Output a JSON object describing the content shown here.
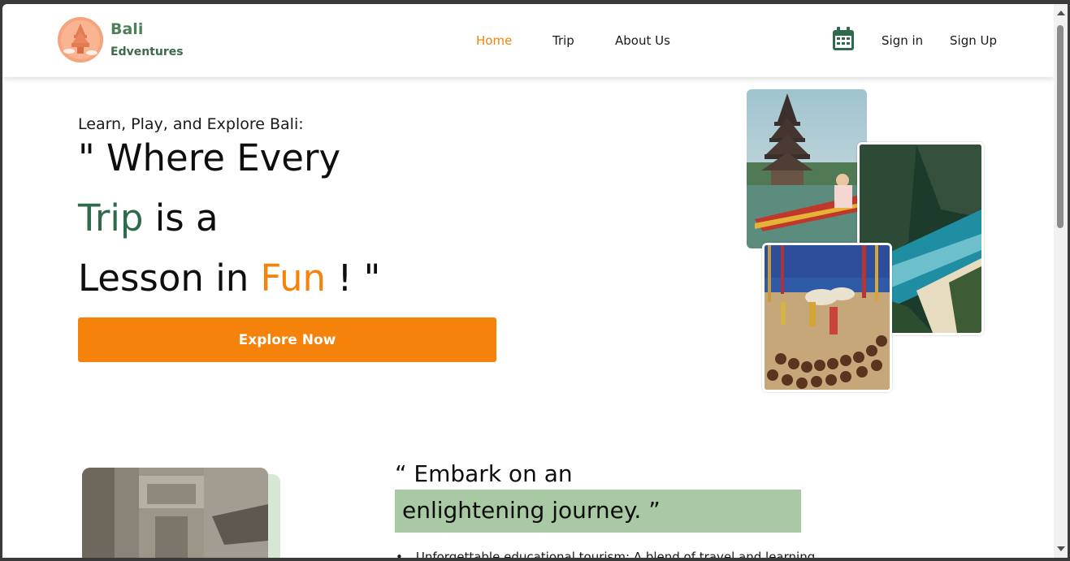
{
  "brand": {
    "name": "Bali",
    "tagline": "Edventures"
  },
  "nav": {
    "links": [
      {
        "label": "Home",
        "active": true
      },
      {
        "label": "Trip",
        "active": false
      },
      {
        "label": "About Us",
        "active": false
      }
    ],
    "calendar_icon": "calendar-icon",
    "sign_in": "Sign in",
    "sign_up": "Sign Up"
  },
  "hero": {
    "intro": "Learn, Play, and Explore Bali:",
    "line1": "\" Where Every",
    "line2_highlight": "Trip",
    "line2_rest": " is a",
    "line3_start": "Lesson in ",
    "line3_highlight": "Fun",
    "line3_end": " ! \"",
    "cta_label": "Explore Now"
  },
  "section2": {
    "heading_line1": "“ Embark on an",
    "heading_line2": "enlightening journey. ”",
    "bullet_1": "Unforgettable educational tourism: A blend of travel and learning"
  },
  "colors": {
    "accent_orange": "#f5820a",
    "brand_green": "#2e6a4b",
    "highlight_green": "#a8c9a3"
  }
}
